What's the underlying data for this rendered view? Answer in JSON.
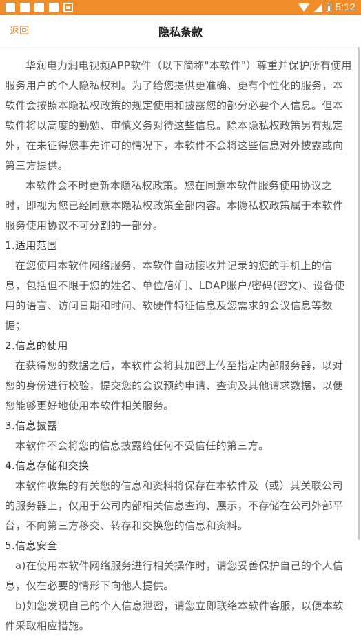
{
  "status_bar": {
    "time": "5:12",
    "icons": [
      "notification-icon",
      "notification-icon",
      "notification-icon",
      "notification-icon",
      "notification-icon",
      "wifi-icon",
      "signal-icon",
      "battery-icon"
    ]
  },
  "nav": {
    "back_label": "返回",
    "title": "隐私条款"
  },
  "content": {
    "intro_p1": "华润电力润电视频APP软件（以下简称\"本软件\"）尊重并保护所有使用服务用户的个人隐私权利。为了给您提供更准确、更有个性化的服务，本软件会按照本隐私权政策的规定使用和披露您的部分必要个人信息。但本软件将以高度的勤勉、审慎义务对待这些信息。除本隐私权政策另有规定外，在未征得您事先许可的情况下，本软件不会将这些信息对外披露或向第三方提供。",
    "intro_p2": "本软件会不时更新本隐私权政策。您在同意本软件服务使用协议之时，即视为您已经同意本隐私权政策全部内容。本隐私权政策属于本软件服务使用协议不可分割的一部分。",
    "s1_title": "1.适用范围",
    "s1_body": "在您使用本软件网络服务，本软件自动接收并记录的您的手机上的信息，包括但不限于您的姓名、单位/部门、LDAP账户/密码(密文)、设备使用的语言、访问日期和时间、软硬件特征信息及您需求的会议信息等数据；",
    "s2_title": "2.信息的使用",
    "s2_body": "在获得您的数据之后，本软件会将其加密上传至指定内部服务器，以对您的身份进行校验，提交您的会议预约申请、查询及其他请求数据，以便您能够更好地使用本软件相关服务。",
    "s3_title": "3.信息披露",
    "s3_body": "本软件不会将您的信息披露给任何不受信任的第三方。",
    "s4_title": "4.信息存储和交换",
    "s4_body": "本软件收集的有关您的信息和资料将保存在本软件及（或）其关联公司的服务器上，仅用于公司内部相关信息查询、展示，不存储在公司外部平台，不向第三方移交、转存和交换您的信息和资料。",
    "s5_title": "5.信息安全",
    "s5_a": "a)在使用本软件网络服务进行相关操作时，请您妥善保护自己的个人信息，仅在必要的情形下向他人提供。",
    "s5_b": "b)如您发现自己的个人信息泄密，请您立即联络本软件客服，以便本软件采取相应措施。"
  }
}
